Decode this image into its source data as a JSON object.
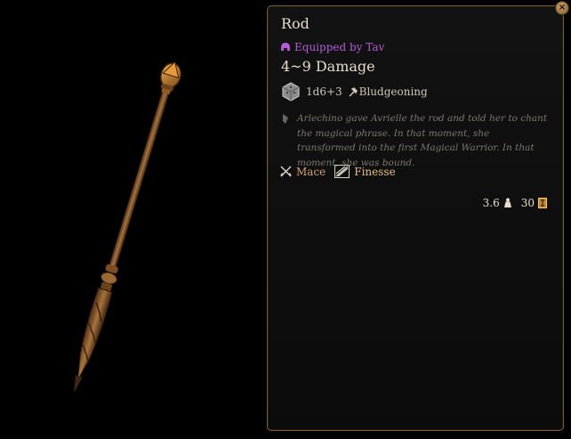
{
  "tooltip": {
    "title": "Rod",
    "equipped_label": "Equipped by Tav",
    "damage": "4~9 Damage",
    "roll": "1d6+3",
    "damage_type": "Bludgeoning",
    "description": "Arlechino gave Avrielle the rod and told her to chant the magical phrase. In that moment, she transformed into the first Magical Warrior. In that moment, she was bound.",
    "properties": [
      {
        "label": "Mace",
        "icon": "crossed-swords-icon"
      },
      {
        "label": "Finesse",
        "icon": "finesse-icon"
      }
    ],
    "weight": "3.6",
    "value": "30",
    "close_symbol": "×"
  },
  "colors": {
    "equipped": "#b45bd8",
    "mace": "#cfa36a",
    "finesse": "#e3c27e",
    "border": "#7a5a3a"
  }
}
